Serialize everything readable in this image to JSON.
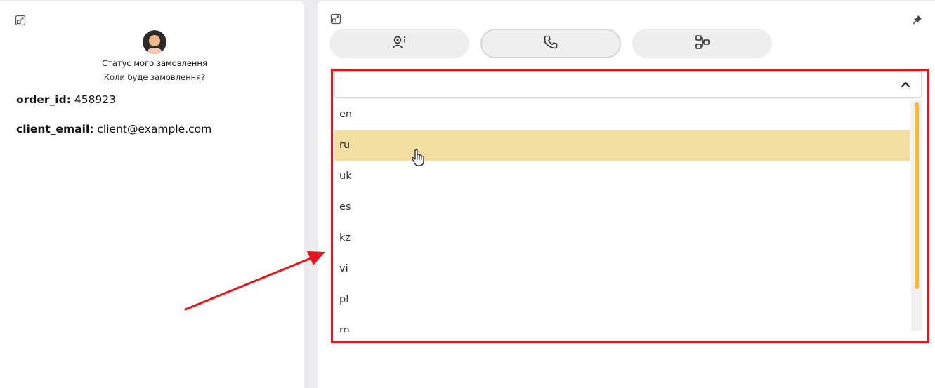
{
  "left_panel": {
    "dialog_title": "Статус мого замовлення",
    "dialog_subtitle": "Коли буде замовлення?",
    "fields": [
      {
        "key": "order_id:",
        "value": "458923"
      },
      {
        "key": "client_email:",
        "value": "client@example.com"
      }
    ]
  },
  "right_panel": {
    "tabs": [
      {
        "name": "contact-info",
        "icon": "person-info-icon"
      },
      {
        "name": "call",
        "icon": "phone-icon",
        "active": true
      },
      {
        "name": "flow",
        "icon": "flow-diagram-icon"
      }
    ],
    "language_select": {
      "value": "",
      "options": [
        "en",
        "ru",
        "uk",
        "es",
        "kz",
        "vi",
        "pl",
        "ro"
      ],
      "hovered_option": "ru",
      "scroll_position": 0.0
    }
  },
  "colors": {
    "highlight_border": "#e8141b",
    "hover_option_bg": "#f3dfa2",
    "scroll_thumb": "#f4b93b",
    "annotation_arrow": "#e8141b"
  }
}
